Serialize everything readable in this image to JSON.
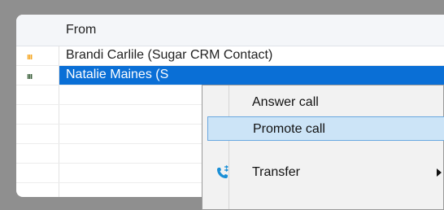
{
  "grid": {
    "header": {
      "from_label": "From"
    },
    "rows": [
      {
        "from": "Brandi Carlile (Sugar CRM Contact)",
        "indicator_color": "#f5a623",
        "selected": false
      },
      {
        "from": "Natalie Maines (S",
        "indicator_color": "#ffffff",
        "selected": true
      }
    ]
  },
  "context_menu": {
    "items": [
      {
        "label": "Answer call",
        "icon": null,
        "submenu": false,
        "highlighted": false
      },
      {
        "label": "Promote call",
        "icon": null,
        "submenu": false,
        "highlighted": true
      },
      {
        "label": "Transfer",
        "icon": "phone-transfer-icon",
        "submenu": true,
        "highlighted": false
      }
    ]
  },
  "colors": {
    "selection": "#0a6fd6",
    "menu_highlight": "#cce4f7",
    "accent_icon": "#1a8fd6"
  }
}
